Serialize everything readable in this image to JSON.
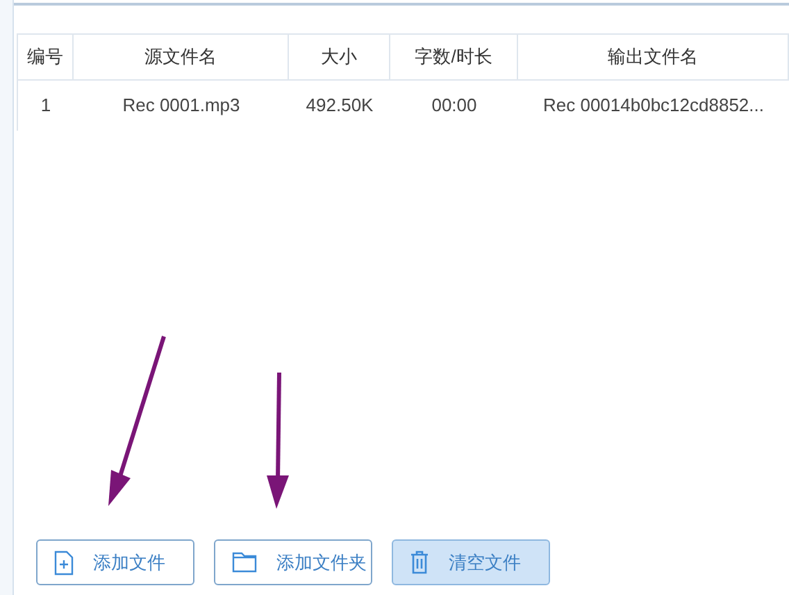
{
  "table": {
    "columns": [
      "编号",
      "源文件名",
      "大小",
      "字数/时长",
      "输出文件名"
    ],
    "rows": [
      [
        "1",
        "Rec 0001.mp3",
        "492.50K",
        "00:00",
        "Rec 00014b0bc12cd8852..."
      ]
    ]
  },
  "buttons": [
    {
      "label": "添加文件",
      "kind": "file",
      "highlighted": false
    },
    {
      "label": "添加文件夹",
      "kind": "folder",
      "highlighted": false
    },
    {
      "label": "清空文件",
      "kind": "trash",
      "highlighted": true
    }
  ]
}
